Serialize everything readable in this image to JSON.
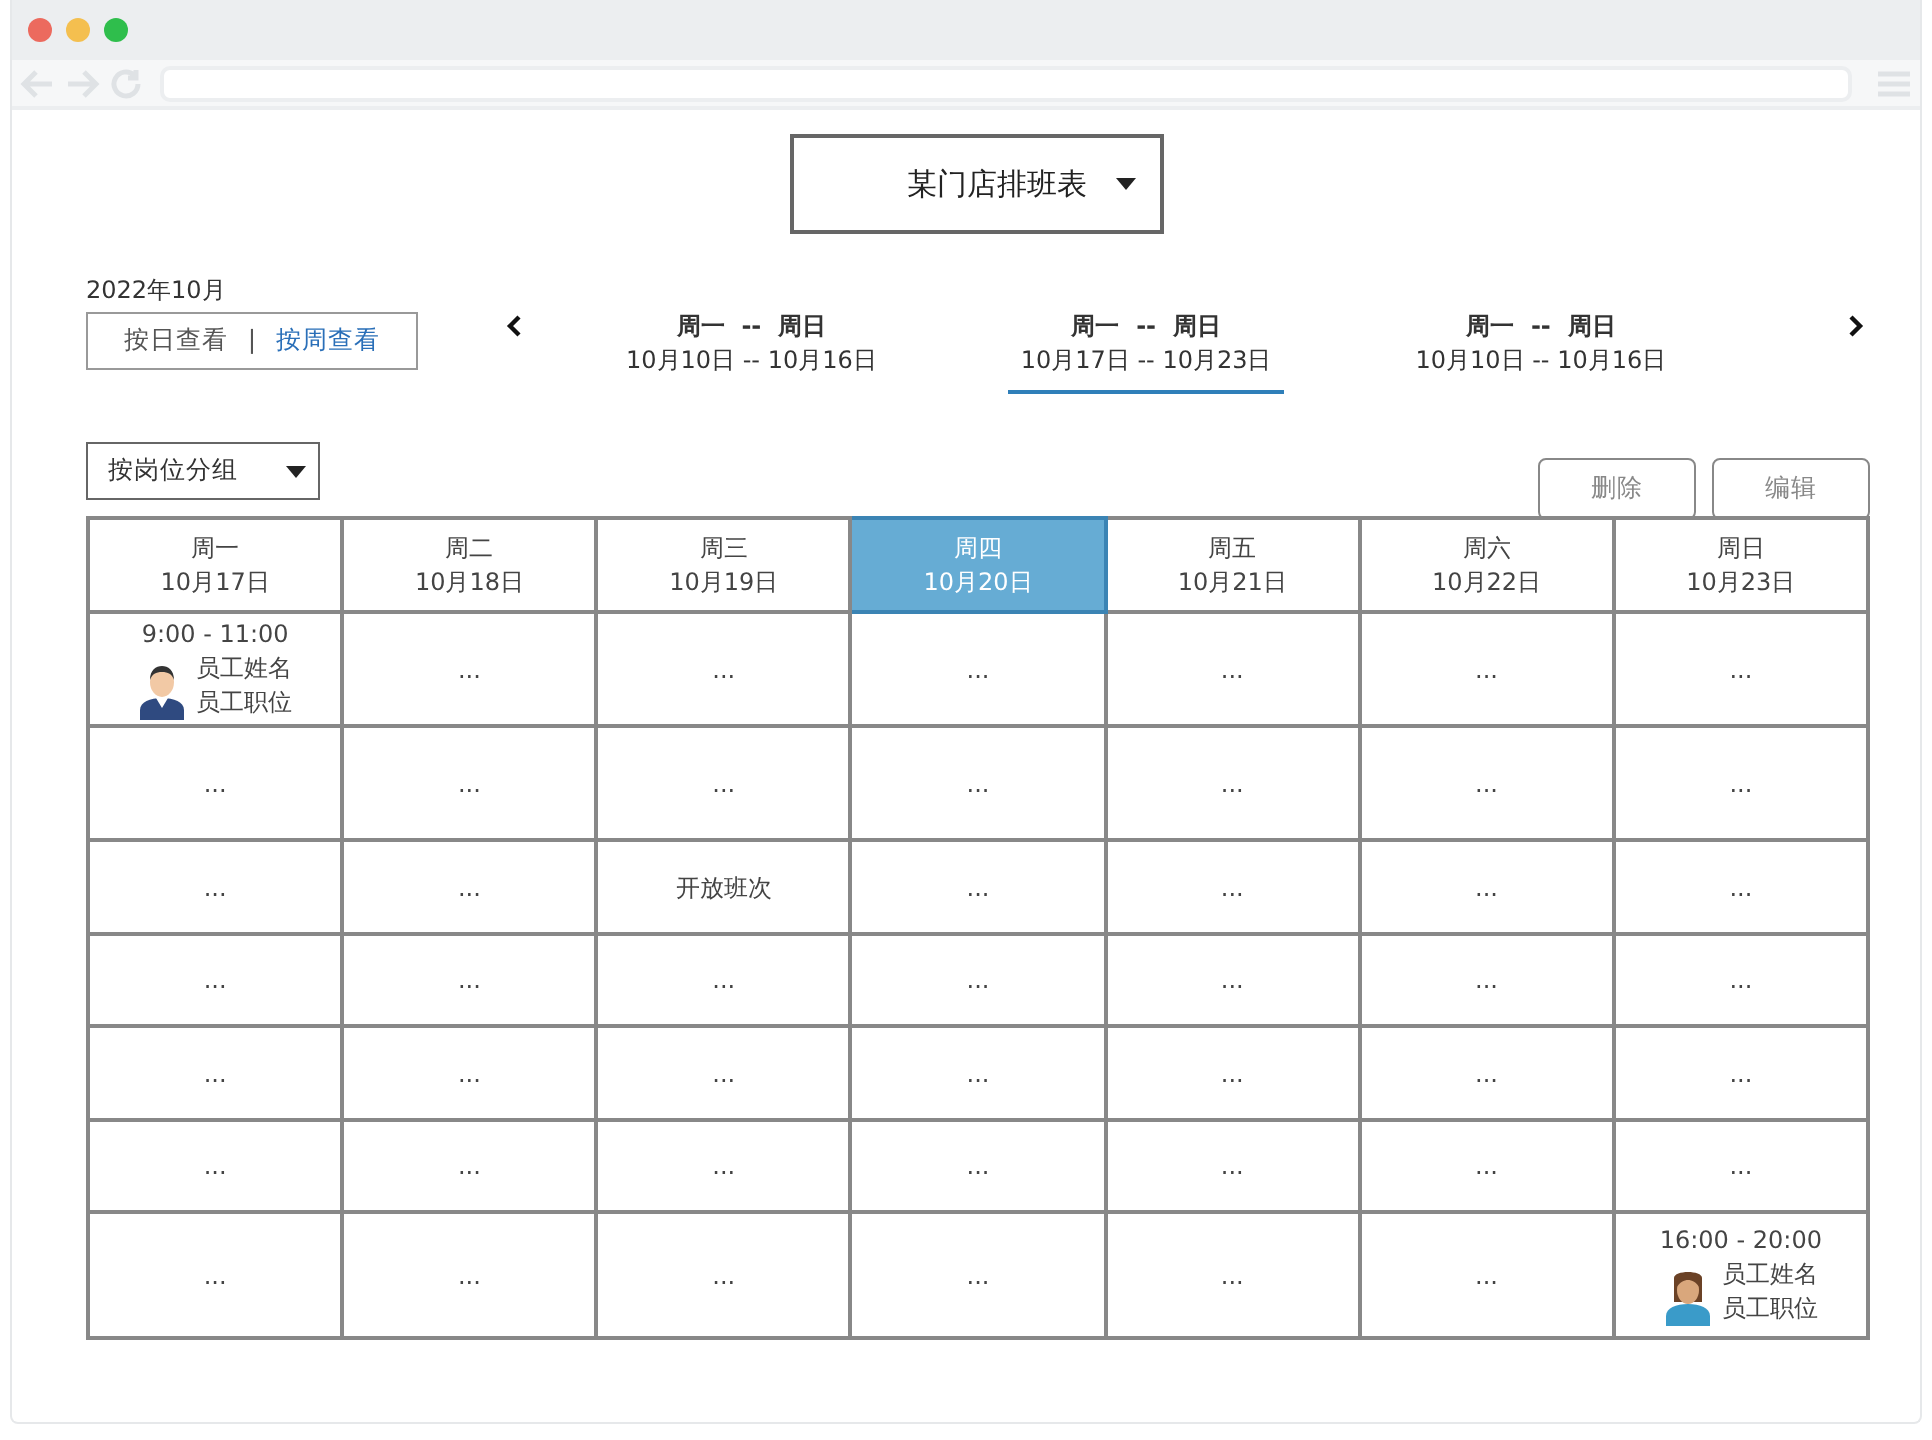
{
  "title_select": {
    "label": "某门店排班表"
  },
  "month": "2022年10月",
  "view_toggle": [
    {
      "label": "按日查看",
      "selected": false
    },
    {
      "label": "按周查看",
      "selected": true
    }
  ],
  "view_separator": "|",
  "week_tabs": [
    {
      "range": "周一  --  周日",
      "dates": "10月10日 -- 10月16日",
      "selected": false
    },
    {
      "range": "周一  --  周日",
      "dates": "10月17日 -- 10月23日",
      "selected": true
    },
    {
      "range": "周一  --  周日",
      "dates": "10月10日 -- 10月16日",
      "selected": false
    }
  ],
  "group_select": {
    "label": "按岗位分组"
  },
  "buttons": [
    "删除",
    "编辑"
  ],
  "days": [
    {
      "day": "周一",
      "date": "10月17日",
      "selected": false
    },
    {
      "day": "周二",
      "date": "10月18日",
      "selected": false
    },
    {
      "day": "周三",
      "date": "10月19日",
      "selected": false
    },
    {
      "day": "周四",
      "date": "10月20日",
      "selected": true
    },
    {
      "day": "周五",
      "date": "10月21日",
      "selected": false
    },
    {
      "day": "周六",
      "date": "10月22日",
      "selected": false
    },
    {
      "day": "周日",
      "date": "10月23日",
      "selected": false
    }
  ],
  "rows": [
    [
      {
        "kind": "shift",
        "time": "9:00 - 11:00",
        "name": "员工姓名",
        "position": "员工职位",
        "avatar": {
          "kind": "man"
        }
      },
      {
        "kind": "empty",
        "text": "..."
      },
      {
        "kind": "empty",
        "text": "..."
      },
      {
        "kind": "empty",
        "text": "..."
      },
      {
        "kind": "empty",
        "text": "..."
      },
      {
        "kind": "empty",
        "text": "..."
      },
      {
        "kind": "empty",
        "text": "..."
      }
    ],
    [
      {
        "kind": "empty",
        "text": "..."
      },
      {
        "kind": "empty",
        "text": "..."
      },
      {
        "kind": "empty",
        "text": "..."
      },
      {
        "kind": "empty",
        "text": "..."
      },
      {
        "kind": "empty",
        "text": "..."
      },
      {
        "kind": "empty",
        "text": "..."
      },
      {
        "kind": "empty",
        "text": "..."
      }
    ],
    [
      {
        "kind": "empty",
        "text": "..."
      },
      {
        "kind": "empty",
        "text": "..."
      },
      {
        "kind": "open",
        "text": "开放班次"
      },
      {
        "kind": "empty",
        "text": "..."
      },
      {
        "kind": "empty",
        "text": "..."
      },
      {
        "kind": "empty",
        "text": "..."
      },
      {
        "kind": "empty",
        "text": "..."
      }
    ],
    [
      {
        "kind": "empty",
        "text": "..."
      },
      {
        "kind": "empty",
        "text": "..."
      },
      {
        "kind": "empty",
        "text": "..."
      },
      {
        "kind": "empty",
        "text": "..."
      },
      {
        "kind": "empty",
        "text": "..."
      },
      {
        "kind": "empty",
        "text": "..."
      },
      {
        "kind": "empty",
        "text": "..."
      }
    ],
    [
      {
        "kind": "empty",
        "text": "..."
      },
      {
        "kind": "empty",
        "text": "..."
      },
      {
        "kind": "empty",
        "text": "..."
      },
      {
        "kind": "empty",
        "text": "..."
      },
      {
        "kind": "empty",
        "text": "..."
      },
      {
        "kind": "empty",
        "text": "..."
      },
      {
        "kind": "empty",
        "text": "..."
      }
    ],
    [
      {
        "kind": "empty",
        "text": "..."
      },
      {
        "kind": "empty",
        "text": "..."
      },
      {
        "kind": "empty",
        "text": "..."
      },
      {
        "kind": "empty",
        "text": "..."
      },
      {
        "kind": "empty",
        "text": "..."
      },
      {
        "kind": "empty",
        "text": "..."
      },
      {
        "kind": "empty",
        "text": "..."
      }
    ],
    [
      {
        "kind": "empty",
        "text": "..."
      },
      {
        "kind": "empty",
        "text": "..."
      },
      {
        "kind": "empty",
        "text": "..."
      },
      {
        "kind": "empty",
        "text": "..."
      },
      {
        "kind": "empty",
        "text": "..."
      },
      {
        "kind": "empty",
        "text": "..."
      },
      {
        "kind": "shift",
        "time": "16:00 - 20:00",
        "name": "员工姓名",
        "position": "员工职位",
        "avatar": {
          "kind": "woman"
        }
      }
    ]
  ]
}
